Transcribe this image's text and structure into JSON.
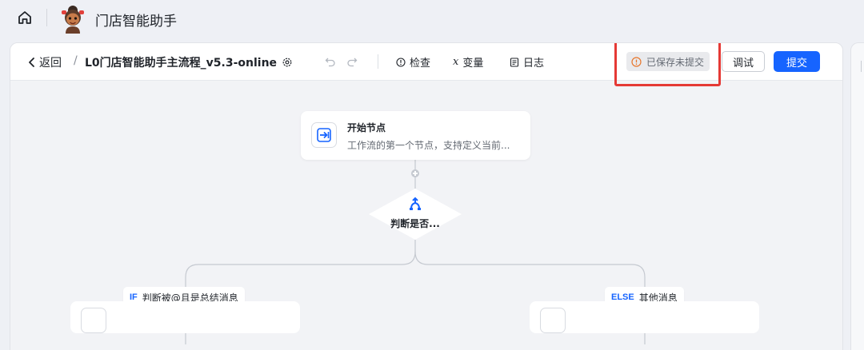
{
  "app": {
    "title": "门店智能助手",
    "home_icon": "home-icon",
    "avatar_icon": "assistant-avatar-icon"
  },
  "toolbar": {
    "back_label": "返回",
    "breadcrumb_separator": "/",
    "flow_title": "L0门店智能助手主流程_v5.3-online",
    "settings_icon": "gear-icon",
    "undo_icon": "undo-icon",
    "redo_icon": "redo-icon",
    "check_label": "检查",
    "variables_label": "变量",
    "log_label": "日志",
    "status_label": "已保存未提交",
    "debug_label": "调试",
    "submit_label": "提交"
  },
  "colors": {
    "primary": "#1664ff",
    "warning": "#e8762b",
    "highlight": "#e53935"
  },
  "canvas": {
    "start_node": {
      "title": "开始节点",
      "description": "工作流的第一个节点，支持定义当前...",
      "icon": "enter-icon"
    },
    "condition_node": {
      "label": "判断是否...",
      "icon": "branch-icon"
    },
    "branches": [
      {
        "tag": "IF",
        "label": "判断被@且是总结消息"
      },
      {
        "tag": "ELSE",
        "label": "其他消息"
      }
    ]
  }
}
